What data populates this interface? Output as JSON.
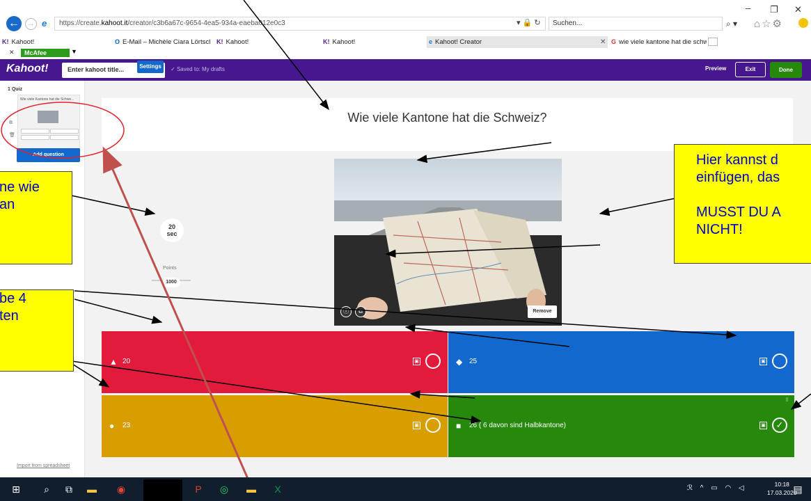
{
  "browser": {
    "url_host": "https://create.",
    "url_domain": "kahoot.it",
    "url_path": "/creator/c3b6a67c-9654-4ea5-934a-eaeba012e0c3",
    "search_placeholder": "Suchen...",
    "favorites_menu_items": {
      "mcafee_label": "McAfee"
    },
    "tabs": [
      {
        "label": "Kahoot!",
        "icon": "K!"
      },
      {
        "label": "E-Mail – Michèle Ciara Lörtsch...",
        "icon": "O"
      },
      {
        "label": "Kahoot!",
        "icon": "K!"
      },
      {
        "label": "Kahoot!",
        "icon": "K!"
      },
      {
        "label": "Kahoot! Creator",
        "icon": "e"
      },
      {
        "label": "wie viele kantone hat die schw...",
        "icon": "G"
      }
    ]
  },
  "kahoot_header": {
    "logo": "Kahoot!",
    "title_placeholder": "Enter kahoot title...",
    "settings_label": "Settings",
    "saved_status": "Saved to: My drafts",
    "preview_label": "Preview",
    "exit_label": "Exit",
    "done_label": "Done"
  },
  "sidebar": {
    "quiz_label": "1 Quiz",
    "thumb_question": "Wie viele Kantone hat die Schwe...",
    "add_question_label": "Add question",
    "import_link": "Import from spreadsheet"
  },
  "editor": {
    "question": "Wie viele Kantone hat die Schweiz?",
    "time_limit_value": "20",
    "time_limit_unit": "sec",
    "points_label": "Points",
    "points_value": "1000",
    "remove_media_label": "Remove",
    "answers": [
      {
        "shape": "triangle-icon",
        "text": "20",
        "color": "#e21b3c",
        "correct": false
      },
      {
        "shape": "diamond-icon",
        "text": "25",
        "color": "#1368ce",
        "correct": false
      },
      {
        "shape": "circle-icon",
        "text": "23",
        "color": "#d89e00",
        "correct": false
      },
      {
        "shape": "square-icon",
        "text": "26 ( 6 davon sind Halbkantone)",
        "color": "#26890c",
        "correct": true
      }
    ]
  },
  "annotations": {
    "note_time": "ne wie\nan",
    "note_answers": "be 4\nten",
    "note_image": "Hier kannst d\neinfügen, das\n\nMUSST DU A\nNICHT!"
  },
  "taskbar": {
    "time": "10:18",
    "date": "17.03.2020"
  },
  "colors": {
    "kahoot_purple": "#46178f",
    "button_blue": "#1368ce",
    "done_green": "#26890c",
    "note_yellow": "#ffff00"
  }
}
